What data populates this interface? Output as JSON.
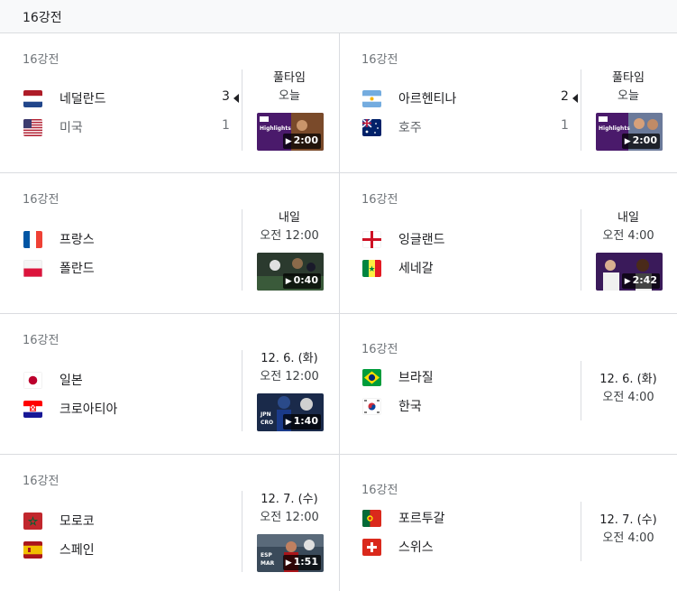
{
  "header": {
    "title": "16강전"
  },
  "matches": [
    {
      "stage": "16강전",
      "home": {
        "name": "네덜란드",
        "score": "3",
        "flag": "netherlands-flag"
      },
      "away": {
        "name": "미국",
        "score": "1",
        "flag": "usa-flag"
      },
      "status1": "풀타임",
      "status2": "오늘",
      "video": "▶ 2:00",
      "winner": "home"
    },
    {
      "stage": "16강전",
      "home": {
        "name": "아르헨티나",
        "score": "2",
        "flag": "argentina-flag"
      },
      "away": {
        "name": "호주",
        "score": "1",
        "flag": "australia-flag"
      },
      "status1": "풀타임",
      "status2": "오늘",
      "video": "▶ 2:00",
      "winner": "home"
    },
    {
      "stage": "16강전",
      "home": {
        "name": "프랑스",
        "flag": "france-flag"
      },
      "away": {
        "name": "폴란드",
        "flag": "poland-flag"
      },
      "status1": "내일",
      "status2": "오전 12:00",
      "video": "▶ 0:40"
    },
    {
      "stage": "16강전",
      "home": {
        "name": "잉글랜드",
        "flag": "england-flag"
      },
      "away": {
        "name": "세네갈",
        "flag": "senegal-flag"
      },
      "status1": "내일",
      "status2": "오전 4:00",
      "video": "▶ 2:42"
    },
    {
      "stage": "16강전",
      "home": {
        "name": "일본",
        "flag": "japan-flag"
      },
      "away": {
        "name": "크로아티아",
        "flag": "croatia-flag"
      },
      "status1": "12. 6. (화)",
      "status2": "오전 12:00",
      "video": "▶ 1:40"
    },
    {
      "stage": "16강전",
      "home": {
        "name": "브라질",
        "flag": "brazil-flag"
      },
      "away": {
        "name": "한국",
        "flag": "korea-flag"
      },
      "status1": "12. 6. (화)",
      "status2": "오전 4:00"
    },
    {
      "stage": "16강전",
      "home": {
        "name": "모로코",
        "flag": "morocco-flag"
      },
      "away": {
        "name": "스페인",
        "flag": "spain-flag"
      },
      "status1": "12. 7. (수)",
      "status2": "오전 12:00",
      "video": "▶ 1:51"
    },
    {
      "stage": "16강전",
      "home": {
        "name": "포르투갈",
        "flag": "portugal-flag"
      },
      "away": {
        "name": "스위스",
        "flag": "switzerland-flag"
      },
      "status1": "12. 7. (수)",
      "status2": "오전 4:00"
    }
  ],
  "thumb_labels": {
    "highlights": "Highlights",
    "jpn": "JPN",
    "cro": "CRO",
    "esp": "ESP",
    "mar": "MAR"
  }
}
